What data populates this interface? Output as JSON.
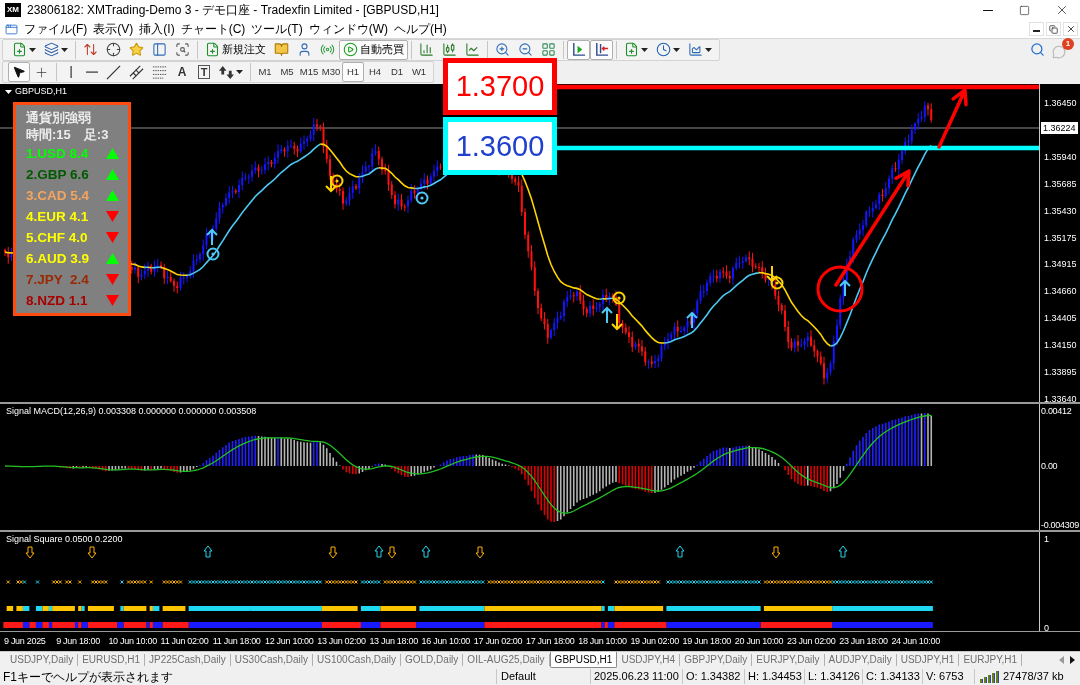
{
  "window": {
    "logo": "XM",
    "title": "23806182: XMTrading-Demo 3 - デモ口座 - Tradexfin Limited - [GBPUSD,H1]"
  },
  "menu": [
    "ファイル(F)",
    "表示(V)",
    "挿入(I)",
    "チャート(C)",
    "ツール(T)",
    "ウィンドウ(W)",
    "ヘルプ(H)"
  ],
  "toolbar": {
    "new_order": {
      "label": "新規注文"
    },
    "auto_trading": {
      "label": "自動売買",
      "on": true
    },
    "auto_scroll": {
      "on": true
    },
    "chart_shift": {
      "on": true
    },
    "notifications": {
      "count": "1"
    }
  },
  "drawing_tools": {
    "cursor": {
      "selected": true
    },
    "crosshair": {
      "selected": false
    },
    "text_tool": "A",
    "label_tool": "T"
  },
  "timeframes": [
    {
      "label": "M1",
      "selected": false
    },
    {
      "label": "M5",
      "selected": false
    },
    {
      "label": "M15",
      "selected": false
    },
    {
      "label": "M30",
      "selected": false
    },
    {
      "label": "H1",
      "selected": true
    },
    {
      "label": "H4",
      "selected": false
    },
    {
      "label": "D1",
      "selected": false
    },
    {
      "label": "W1",
      "selected": false
    }
  ],
  "chart": {
    "symbol": "GBPUSD,H1",
    "price_axis": [
      "1.36450",
      "1.35940",
      "1.35685",
      "1.35430",
      "1.35175",
      "1.34915",
      "1.34660",
      "1.34405",
      "1.34150",
      "1.33895",
      "1.33640"
    ],
    "current_price": "1.36224",
    "levels": [
      {
        "label": "1.3700",
        "color": "#ff0000",
        "frame": {
          "color": "#ff0000"
        }
      },
      {
        "label": "1.3600",
        "color": "#1f3fce",
        "frame": {
          "color": "#00ffff"
        }
      }
    ],
    "strength_panel": {
      "title": "通貨別強弱",
      "period": "時間:15",
      "bars": "足:3",
      "rows": [
        {
          "label": "1.USD 8.4",
          "color": "#00ff00",
          "kind": "up"
        },
        {
          "label": "2.GBP 6.6",
          "color": "#005a00",
          "kind": "up"
        },
        {
          "label": "3.CAD 5.4",
          "color": "#f4a460",
          "kind": "up"
        },
        {
          "label": "4.EUR 4.1",
          "color": "#ffff00",
          "kind": "down"
        },
        {
          "label": "5.CHF 4.0",
          "color": "#ffff00",
          "kind": "down"
        },
        {
          "label": "6.AUD 3.9",
          "color": "#ffff00",
          "kind": "up"
        },
        {
          "label": "7.JPY  2.4",
          "color": "#9a2800",
          "kind": "down"
        },
        {
          "label": "8.NZD 1.1",
          "color": "#a80000",
          "kind": "down"
        }
      ]
    }
  },
  "macd": {
    "label": "Signal MACD(12,26,9) 0.003308 0.000000 0.000000 0.003508",
    "axis": [
      "0.00412",
      "0.00",
      "-0.004309"
    ]
  },
  "signal_square": {
    "label": "Signal Square 0.0500 0.2200",
    "axis": [
      "1",
      "0"
    ]
  },
  "time_axis": [
    "9 Jun 2025",
    "9 Jun 18:00",
    "10 Jun 10:00",
    "11 Jun 02:00",
    "11 Jun 18:00",
    "12 Jun 10:00",
    "13 Jun 02:00",
    "13 Jun 18:00",
    "16 Jun 10:00",
    "17 Jun 02:00",
    "17 Jun 18:00",
    "18 Jun 10:00",
    "19 Jun 02:00",
    "19 Jun 18:00",
    "20 Jun 10:00",
    "23 Jun 02:00",
    "23 Jun 18:00",
    "24 Jun 10:00"
  ],
  "tabs": [
    {
      "label": "USDJPY,Daily",
      "selected": false
    },
    {
      "label": "EURUSD,H1",
      "selected": false
    },
    {
      "label": "JP225Cash,Daily",
      "selected": false
    },
    {
      "label": "US30Cash,Daily",
      "selected": false
    },
    {
      "label": "US100Cash,Daily",
      "selected": false
    },
    {
      "label": "GOLD,Daily",
      "selected": false
    },
    {
      "label": "OIL-AUG25,Daily",
      "selected": false
    },
    {
      "label": "GBPUSD,H1",
      "selected": true
    },
    {
      "label": "USDJPY,H4",
      "selected": false
    },
    {
      "label": "GBPJPY,Daily",
      "selected": false
    },
    {
      "label": "EURJPY,Daily",
      "selected": false
    },
    {
      "label": "AUDJPY,Daily",
      "selected": false
    },
    {
      "label": "USDJPY,H1",
      "selected": false
    },
    {
      "label": "EURJPY,H1",
      "selected": false
    }
  ],
  "status_bar": {
    "help": "F1キーでヘルプが表示されます",
    "profile": "Default",
    "time": "2025.06.23 11:00",
    "open": "O: 1.34382",
    "high": "H: 1.34453",
    "low": "L: 1.34126",
    "close": "C: 1.34133",
    "volume": "V: 6753",
    "traffic": "27478/37 kb"
  }
}
